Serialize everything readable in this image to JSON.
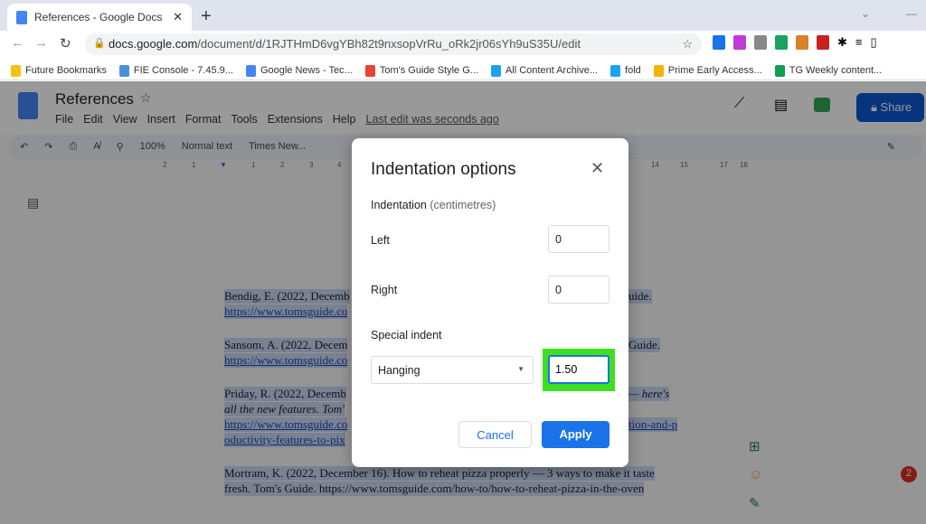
{
  "browser": {
    "tab_title": "References - Google Docs",
    "url_domain": "docs.google.com",
    "url_path": "/document/d/1RJTHmD6vgYBh82t9nxsopVrRu_oRk2jr06sYh9uS35U/edit",
    "bookmarks": [
      {
        "label": "Future Bookmarks",
        "color": "#f4c20d"
      },
      {
        "label": "FIE Console - 7.45.9...",
        "color": "#4a90d9"
      },
      {
        "label": "Google News - Tec...",
        "color": "#4285f4"
      },
      {
        "label": "Tom's Guide Style G...",
        "color": "#ea4335"
      },
      {
        "label": "All Content Archive...",
        "color": "#1da1f2"
      },
      {
        "label": "fold",
        "color": "#1da1f2"
      },
      {
        "label": "Prime Early Access...",
        "color": "#f4b400"
      },
      {
        "label": "TG Weekly content...",
        "color": "#0f9d58"
      }
    ]
  },
  "docs": {
    "title": "References",
    "menu": [
      "File",
      "Edit",
      "View",
      "Insert",
      "Format",
      "Tools",
      "Extensions",
      "Help"
    ],
    "last_edit": "Last edit was seconds ago",
    "share": "Share",
    "toolbar": {
      "zoom": "100%",
      "style": "Normal text",
      "font": "Times New..."
    },
    "ruler": [
      "2",
      "1",
      "1",
      "2",
      "3",
      "4",
      "14",
      "15",
      "17",
      "18"
    ],
    "lines": [
      {
        "left": "Bendig, E. (2022, Decemb",
        "right": "uide."
      },
      {
        "left": "https://www.tomsguide.co",
        "right": ""
      },
      {
        "left": "Sansom, A. (2022, Decem",
        "right": "Guide."
      },
      {
        "left": "https://www.tomsguide.co",
        "right": ""
      },
      {
        "left": "Priday, R. (2022, Decemb",
        "right": "— here's"
      },
      {
        "left": "all the new features. Tom'",
        "right": ""
      },
      {
        "left": "https://www.tomsguide.co",
        "right": "tion-and-p"
      },
      {
        "left": "oductivity-features-to-pix",
        "right": ""
      },
      {
        "left": "Mortram, K. (2022, December 16). How to reheat pizza properly — 3 ways to make it taste",
        "right": ""
      },
      {
        "left": "fresh. Tom's Guide. https://www.tomsguide.com/how-to/how-to-reheat-pizza-in-the-oven",
        "right": ""
      }
    ],
    "notification_count": "2"
  },
  "dialog": {
    "title": "Indentation options",
    "section": "Indentation",
    "unit": "(centimetres)",
    "left_label": "Left",
    "left_value": "0",
    "right_label": "Right",
    "right_value": "0",
    "special_label": "Special indent",
    "special_type": "Hanging",
    "special_value": "1.50",
    "cancel": "Cancel",
    "apply": "Apply",
    "accent": "#1a73e8",
    "highlight": "#3de01f"
  }
}
